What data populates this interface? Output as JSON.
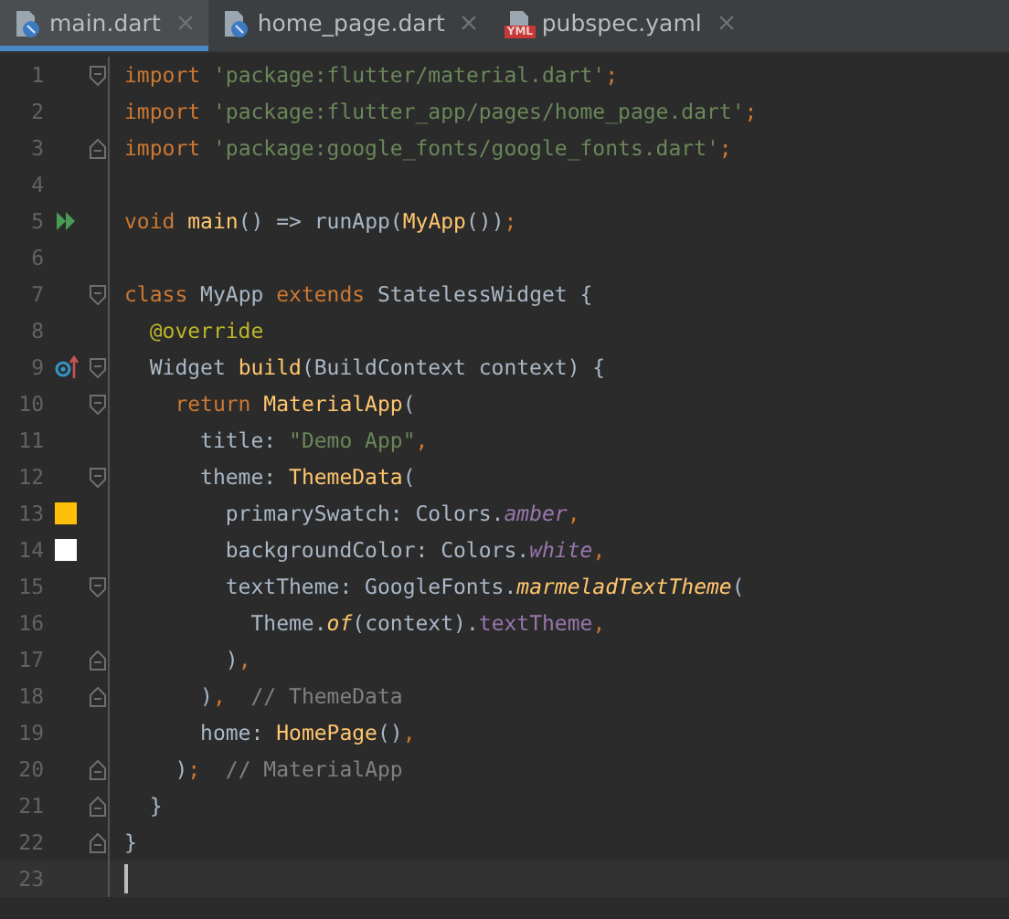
{
  "tabs": [
    {
      "label": "main.dart",
      "kind": "dart",
      "selected": true
    },
    {
      "label": "home_page.dart",
      "kind": "dart",
      "selected": false
    },
    {
      "label": "pubspec.yaml",
      "kind": "yaml",
      "badge": "YML",
      "selected": false
    }
  ],
  "lines": [
    {
      "number": "1",
      "fold": {
        "kind": "start"
      },
      "tokens": [
        {
          "kind": "kw",
          "text": "import "
        },
        {
          "kind": "str",
          "text": "'package:flutter/material.dart'"
        },
        {
          "kind": "kw",
          "text": ";"
        }
      ]
    },
    {
      "number": "2",
      "tokens": [
        {
          "kind": "kw",
          "text": "import "
        },
        {
          "kind": "str",
          "text": "'package:flutter_app/pages/home_page.dart'"
        },
        {
          "kind": "kw",
          "text": ";"
        }
      ]
    },
    {
      "number": "3",
      "fold": {
        "kind": "end"
      },
      "tokens": [
        {
          "kind": "kw",
          "text": "import "
        },
        {
          "kind": "str",
          "text": "'package:google_fonts/google_fonts.dart'"
        },
        {
          "kind": "kw",
          "text": ";"
        }
      ]
    },
    {
      "number": "4"
    },
    {
      "number": "5",
      "marker": {
        "kind": "run"
      },
      "tokens": [
        {
          "kind": "kw",
          "text": "void "
        },
        {
          "kind": "fn",
          "text": "main"
        },
        {
          "kind": "plain",
          "text": "() => runApp("
        },
        {
          "kind": "fn",
          "text": "MyApp"
        },
        {
          "kind": "plain",
          "text": "())"
        },
        {
          "kind": "kw",
          "text": ";"
        }
      ]
    },
    {
      "number": "6"
    },
    {
      "number": "7",
      "fold": {
        "kind": "start"
      },
      "tokens": [
        {
          "kind": "kw",
          "text": "class "
        },
        {
          "kind": "plain",
          "text": "MyApp "
        },
        {
          "kind": "kw",
          "text": "extends "
        },
        {
          "kind": "plain",
          "text": "StatelessWidget {"
        }
      ]
    },
    {
      "number": "8",
      "tokens": [
        {
          "kind": "ann",
          "text": "  @override"
        }
      ]
    },
    {
      "number": "9",
      "fold": {
        "kind": "start"
      },
      "marker": {
        "kind": "override"
      },
      "tokens": [
        {
          "kind": "plain",
          "text": "  Widget "
        },
        {
          "kind": "fn",
          "text": "build"
        },
        {
          "kind": "plain",
          "text": "(BuildContext context) {"
        }
      ]
    },
    {
      "number": "10",
      "fold": {
        "kind": "start"
      },
      "tokens": [
        {
          "kind": "kw",
          "text": "    return "
        },
        {
          "kind": "fn",
          "text": "MaterialApp"
        },
        {
          "kind": "plain",
          "text": "("
        }
      ]
    },
    {
      "number": "11",
      "tokens": [
        {
          "kind": "plain",
          "text": "      title: "
        },
        {
          "kind": "str",
          "text": "\"Demo App\""
        },
        {
          "kind": "kw",
          "text": ","
        }
      ]
    },
    {
      "number": "12",
      "fold": {
        "kind": "start"
      },
      "tokens": [
        {
          "kind": "plain",
          "text": "      theme: "
        },
        {
          "kind": "fn",
          "text": "ThemeData"
        },
        {
          "kind": "plain",
          "text": "("
        }
      ]
    },
    {
      "number": "13",
      "marker": {
        "kind": "swatch",
        "color": "#ffc107"
      },
      "tokens": [
        {
          "kind": "plain",
          "text": "        primarySwatch: Colors."
        },
        {
          "kind": "ital",
          "text": "amber"
        },
        {
          "kind": "kw",
          "text": ","
        }
      ]
    },
    {
      "number": "14",
      "marker": {
        "kind": "swatch",
        "color": "#ffffff"
      },
      "tokens": [
        {
          "kind": "plain",
          "text": "        backgroundColor: Colors."
        },
        {
          "kind": "ital",
          "text": "white"
        },
        {
          "kind": "kw",
          "text": ","
        }
      ]
    },
    {
      "number": "15",
      "fold": {
        "kind": "start"
      },
      "tokens": [
        {
          "kind": "plain",
          "text": "        textTheme: GoogleFonts."
        },
        {
          "kind": "fnital",
          "text": "marmeladTextTheme"
        },
        {
          "kind": "plain",
          "text": "("
        }
      ]
    },
    {
      "number": "16",
      "tokens": [
        {
          "kind": "plain",
          "text": "          Theme."
        },
        {
          "kind": "fnital",
          "text": "of"
        },
        {
          "kind": "plain",
          "text": "(context)."
        },
        {
          "kind": "prop",
          "text": "textTheme"
        },
        {
          "kind": "kw",
          "text": ","
        }
      ]
    },
    {
      "number": "17",
      "fold": {
        "kind": "end"
      },
      "tokens": [
        {
          "kind": "plain",
          "text": "        )"
        },
        {
          "kind": "kw",
          "text": ","
        }
      ]
    },
    {
      "number": "18",
      "fold": {
        "kind": "end"
      },
      "tokens": [
        {
          "kind": "plain",
          "text": "      )"
        },
        {
          "kind": "kw",
          "text": ",  "
        },
        {
          "kind": "comment",
          "text": "// ThemeData"
        }
      ]
    },
    {
      "number": "19",
      "tokens": [
        {
          "kind": "plain",
          "text": "      home: "
        },
        {
          "kind": "fn",
          "text": "HomePage"
        },
        {
          "kind": "plain",
          "text": "()"
        },
        {
          "kind": "kw",
          "text": ","
        }
      ]
    },
    {
      "number": "20",
      "fold": {
        "kind": "end"
      },
      "tokens": [
        {
          "kind": "plain",
          "text": "    )"
        },
        {
          "kind": "kw",
          "text": ";  "
        },
        {
          "kind": "comment",
          "text": "// MaterialApp"
        }
      ]
    },
    {
      "number": "21",
      "fold": {
        "kind": "end"
      },
      "tokens": [
        {
          "kind": "plain",
          "text": "  }"
        }
      ]
    },
    {
      "number": "22",
      "fold": {
        "kind": "end"
      },
      "tokens": [
        {
          "kind": "plain",
          "text": "}"
        }
      ]
    },
    {
      "number": "23",
      "current": true
    }
  ]
}
